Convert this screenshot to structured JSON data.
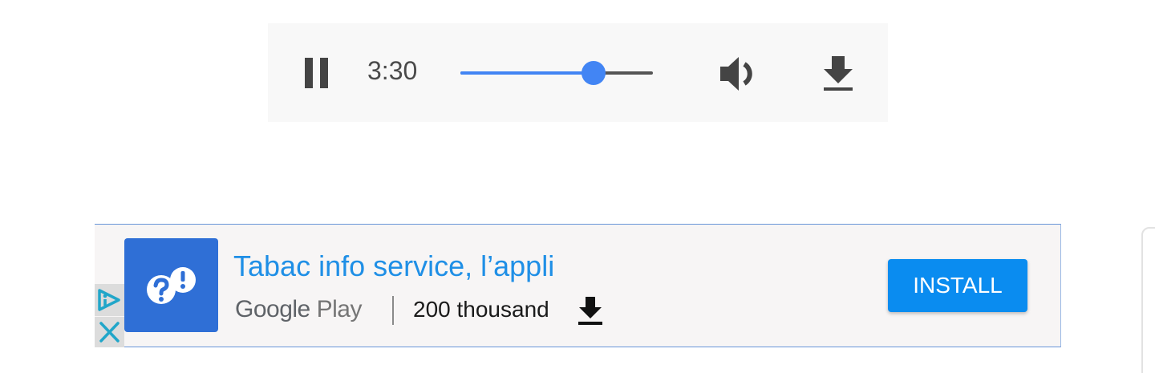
{
  "player": {
    "time": "3:30",
    "progress": 0.69,
    "colors": {
      "accent": "#4285f4",
      "icon": "#4a4a4a",
      "background": "#f8f8f8"
    },
    "icons": [
      "pause-icon",
      "volume-icon",
      "download-icon"
    ]
  },
  "ad": {
    "title": "Tabac info service, l’appli",
    "store_google": "Google",
    "store_play": "Play",
    "downloads": "200 thousand",
    "install_label": "INSTALL",
    "colors": {
      "title": "#1f8fe6",
      "install": "#0a8cf0",
      "icon_bg": "#2f6fd6",
      "adchoices": "#21a6c9"
    },
    "icons": [
      "app-icon",
      "adchoices-icon",
      "close-icon",
      "download-icon"
    ]
  }
}
